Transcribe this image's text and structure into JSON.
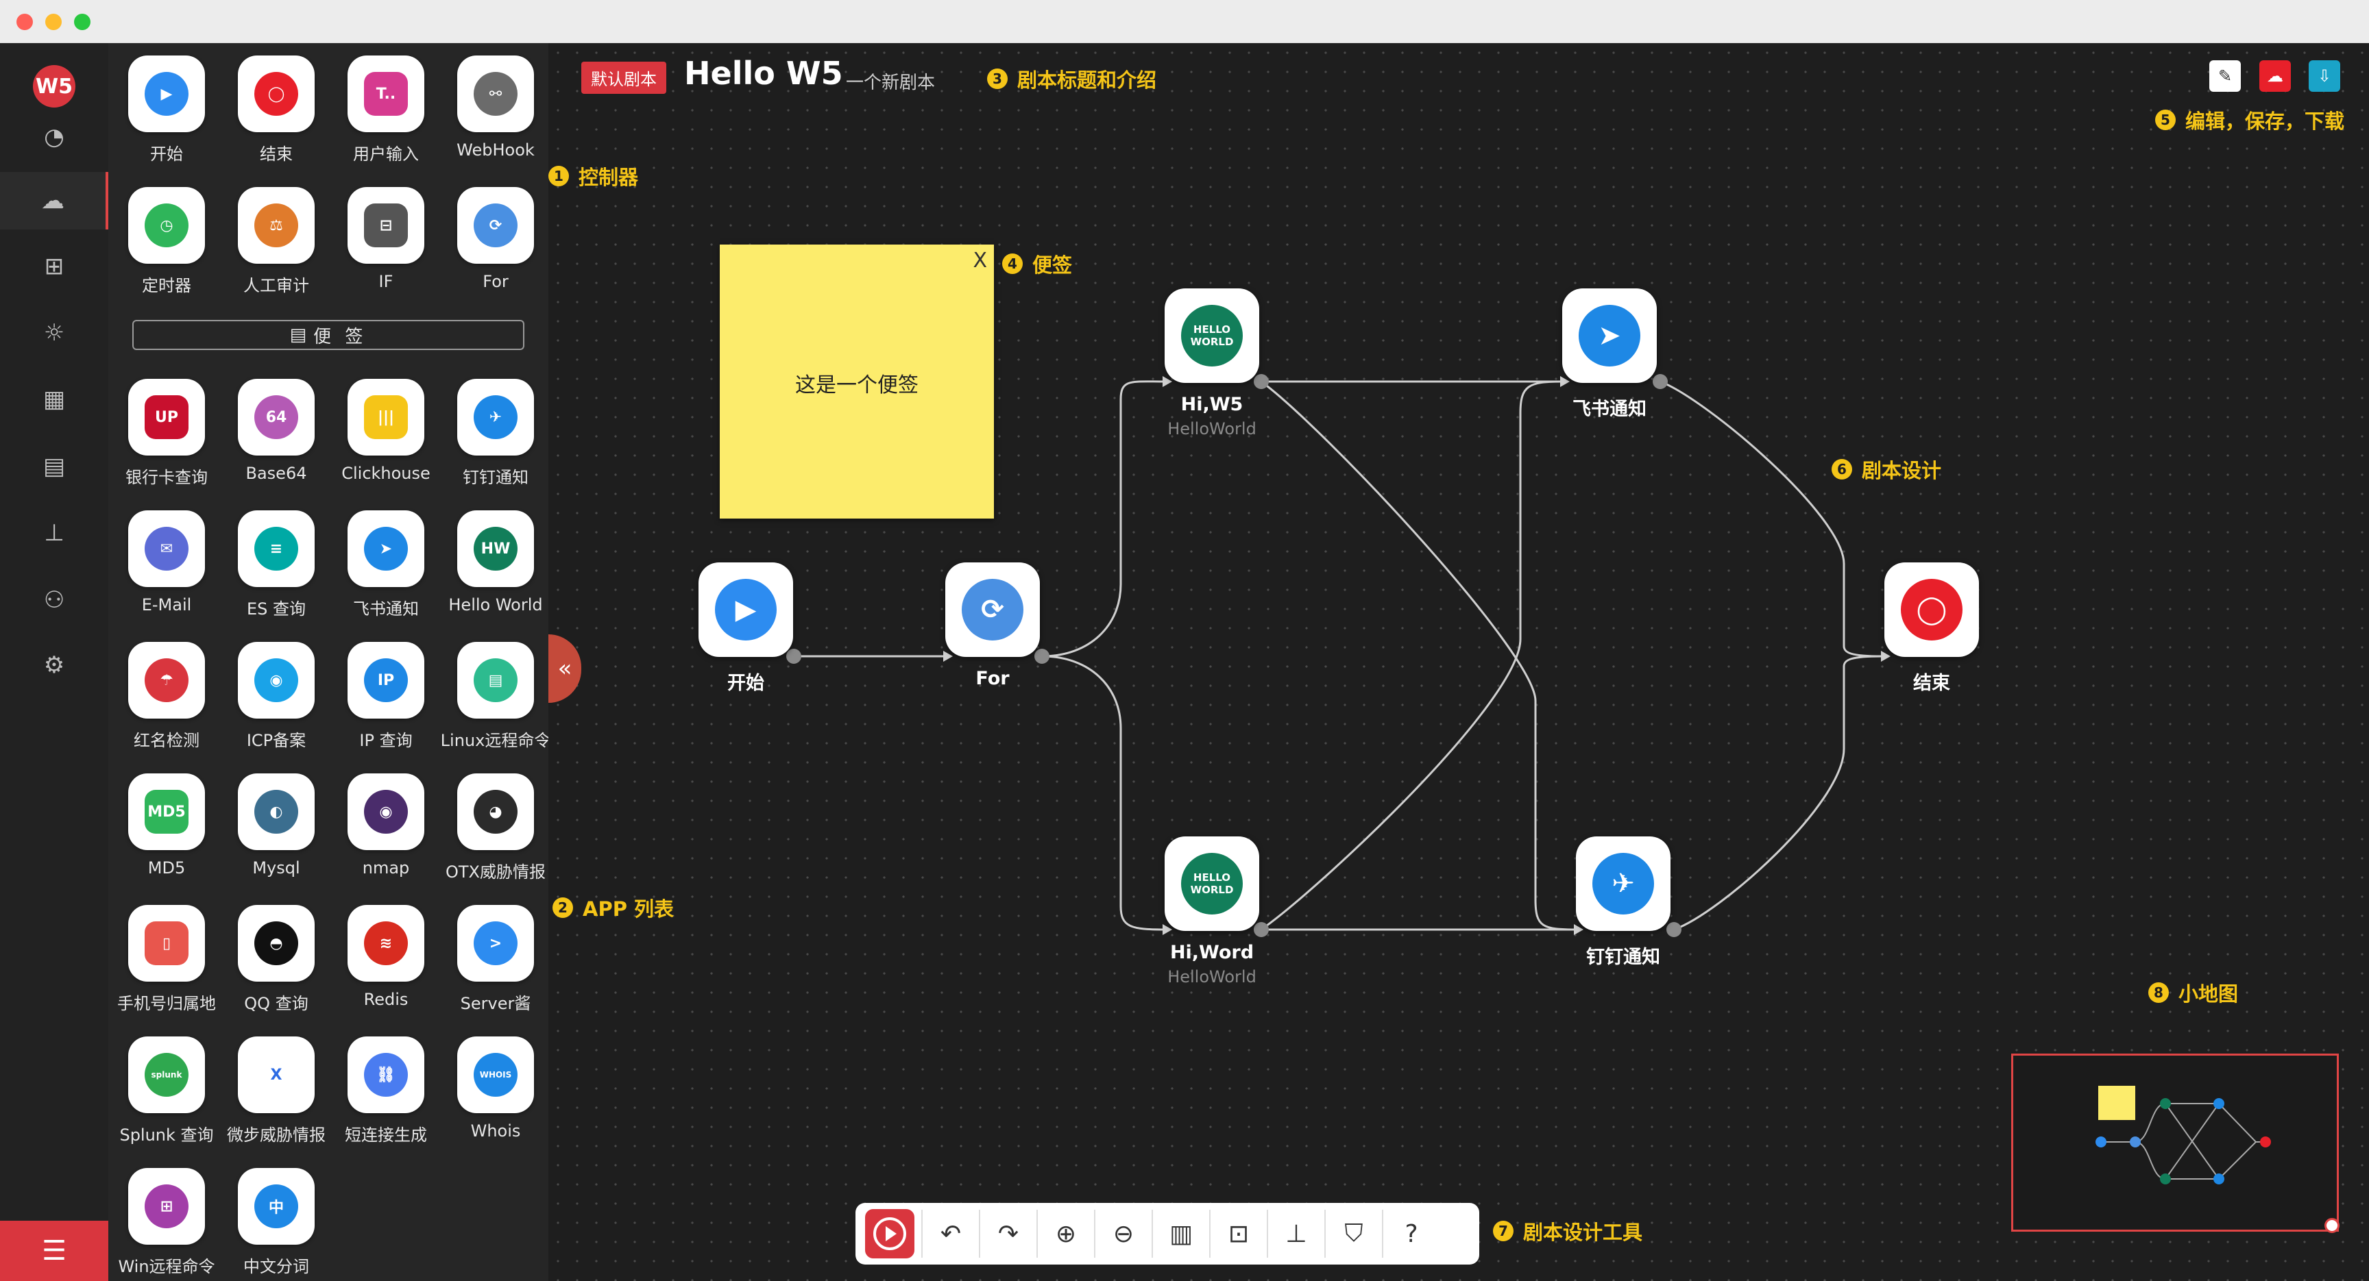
{
  "script": {
    "badge": "默认剧本",
    "title": "Hello W5",
    "desc": "一个新剧本"
  },
  "sidebar": {
    "logo": "W5",
    "items": [
      {
        "icon": "dashboard-icon",
        "glyph": "◔"
      },
      {
        "icon": "cloud-workflow-icon",
        "glyph": "☁",
        "active": true
      },
      {
        "icon": "hierarchy-icon",
        "glyph": "⊞"
      },
      {
        "icon": "bug-icon",
        "glyph": "☼"
      },
      {
        "icon": "apps-grid-icon",
        "glyph": "▦"
      },
      {
        "icon": "document-icon",
        "glyph": "▤"
      },
      {
        "icon": "org-chart-icon",
        "glyph": "⊥"
      },
      {
        "icon": "user-icon",
        "glyph": "⚇"
      },
      {
        "icon": "settings-icon",
        "glyph": "⚙"
      }
    ],
    "bottom_glyph": "☰"
  },
  "note_button": {
    "icon": "▤",
    "label": "便 签"
  },
  "apps": [
    {
      "name": "开始",
      "icon": "start-icon",
      "glyph": "▶",
      "color": "#2d8cf0",
      "shape": "circ"
    },
    {
      "name": "结束",
      "icon": "end-icon",
      "glyph": "◯",
      "color": "#e8202a",
      "shape": "circ"
    },
    {
      "name": "用户输入",
      "icon": "user-input-icon",
      "glyph": "T..",
      "color": "#d63a8f",
      "shape": "sqr"
    },
    {
      "name": "WebHook",
      "icon": "webhook-icon",
      "glyph": "⚯",
      "color": "#6b6b6b",
      "shape": "circ"
    },
    {
      "name": "定时器",
      "icon": "timer-icon",
      "glyph": "◷",
      "color": "#2fb55a",
      "shape": "circ"
    },
    {
      "name": "人工审计",
      "icon": "audit-icon",
      "glyph": "⚖",
      "color": "#e07b2c",
      "shape": "circ"
    },
    {
      "name": "IF",
      "icon": "if-icon",
      "glyph": "⊟",
      "color": "#555555",
      "shape": "sqr"
    },
    {
      "name": "For",
      "icon": "for-icon",
      "glyph": "⟳",
      "color": "#4a90e2",
      "shape": "circ"
    },
    {
      "name": "银行卡查询",
      "icon": "unionpay-icon",
      "glyph": "UP",
      "color": "#c8102e",
      "shape": "sqr"
    },
    {
      "name": "Base64",
      "icon": "base64-icon",
      "glyph": "64",
      "color": "#b45ab5",
      "shape": "circ"
    },
    {
      "name": "Clickhouse",
      "icon": "clickhouse-icon",
      "glyph": "|||",
      "color": "#f5c518",
      "shape": "sqr"
    },
    {
      "name": "钉钉通知",
      "icon": "dingtalk-icon",
      "glyph": "✈",
      "color": "#1e88e5",
      "shape": "circ"
    },
    {
      "name": "E-Mail",
      "icon": "email-icon",
      "glyph": "✉",
      "color": "#5c6bd6",
      "shape": "circ"
    },
    {
      "name": "ES 查询",
      "icon": "elasticsearch-icon",
      "glyph": "≡",
      "color": "#00a9a5",
      "shape": "circ"
    },
    {
      "name": "飞书通知",
      "icon": "feishu-icon",
      "glyph": "➤",
      "color": "#1e88e5",
      "shape": "circ"
    },
    {
      "name": "Hello World",
      "icon": "hello-world-icon",
      "glyph": "HW",
      "color": "#127e5a",
      "shape": "circ"
    },
    {
      "name": "红名检测",
      "icon": "umbrella-icon",
      "glyph": "☂",
      "color": "#d9363e",
      "shape": "circ"
    },
    {
      "name": "ICP备案",
      "icon": "globe-icon",
      "glyph": "◉",
      "color": "#1aa3e8",
      "shape": "circ"
    },
    {
      "name": "IP 查询",
      "icon": "ip-icon",
      "glyph": "IP",
      "color": "#1e88e5",
      "shape": "circ"
    },
    {
      "name": "Linux远程命令",
      "icon": "server-icon",
      "glyph": "▤",
      "color": "#2dbb8f",
      "shape": "circ"
    },
    {
      "name": "MD5",
      "icon": "md5-icon",
      "glyph": "MD5",
      "color": "#2fb55a",
      "shape": "sqr"
    },
    {
      "name": "Mysql",
      "icon": "mysql-icon",
      "glyph": "◐",
      "color": "#3b6e8f",
      "shape": "circ"
    },
    {
      "name": "nmap",
      "icon": "nmap-icon",
      "glyph": "◉",
      "color": "#4a2c6b",
      "shape": "circ"
    },
    {
      "name": "OTX威胁情报",
      "icon": "alien-icon",
      "glyph": "◕",
      "color": "#2b2b2b",
      "shape": "circ"
    },
    {
      "name": "手机号归属地",
      "icon": "phone-icon",
      "glyph": "▯",
      "color": "#e8564d",
      "shape": "sqr"
    },
    {
      "name": "QQ 查询",
      "icon": "qq-icon",
      "glyph": "◓",
      "color": "#111111",
      "shape": "circ"
    },
    {
      "name": "Redis",
      "icon": "redis-icon",
      "glyph": "≋",
      "color": "#d82c20",
      "shape": "circ"
    },
    {
      "name": "Server酱",
      "icon": "server-chan-icon",
      "glyph": ">",
      "color": "#2d8cf0",
      "shape": "circ"
    },
    {
      "name": "Splunk 查询",
      "icon": "splunk-icon",
      "glyph": "splunk",
      "color": "#2fa84f",
      "shape": "circ"
    },
    {
      "name": "微步威胁情报",
      "icon": "threatbook-icon",
      "glyph": "X",
      "color": "#ffffff",
      "shape": "sqr",
      "fg": "#2d6be4"
    },
    {
      "name": "短连接生成",
      "icon": "link-icon",
      "glyph": "⛓",
      "color": "#4a7cf0",
      "shape": "circ"
    },
    {
      "name": "Whois",
      "icon": "whois-icon",
      "glyph": "WHOIS",
      "color": "#1e88e5",
      "shape": "circ"
    },
    {
      "name": "Win远程命令",
      "icon": "windows-icon",
      "glyph": "⊞",
      "color": "#a23ea8",
      "shape": "circ"
    },
    {
      "name": "中文分词",
      "icon": "chinese-segment-icon",
      "glyph": "中",
      "color": "#1e88e5",
      "shape": "circ"
    }
  ],
  "sticky": {
    "close": "X",
    "text": "这是一个便签"
  },
  "nodes": [
    {
      "key": "start",
      "name": "开始",
      "sub": "",
      "glyph": "▶",
      "color": "#2d8cf0"
    },
    {
      "key": "for",
      "name": "For",
      "sub": "",
      "glyph": "⟳",
      "color": "#4a90e2"
    },
    {
      "key": "hi1",
      "name": "Hi,W5",
      "sub": "HelloWorld",
      "glyph": "HELLO WORLD",
      "color": "#127e5a"
    },
    {
      "key": "hi2",
      "name": "Hi,Word",
      "sub": "HelloWorld",
      "glyph": "HELLO WORLD",
      "color": "#127e5a"
    },
    {
      "key": "feishu",
      "name": "飞书通知",
      "sub": "",
      "glyph": "➤",
      "color": "#1e88e5"
    },
    {
      "key": "ding",
      "name": "钉钉通知",
      "sub": "",
      "glyph": "✈",
      "color": "#1e88e5"
    },
    {
      "key": "end",
      "name": "结束",
      "sub": "",
      "glyph": "◯",
      "color": "#e8202a"
    }
  ],
  "annotations": [
    {
      "n": "1",
      "text": "控制器"
    },
    {
      "n": "2",
      "text": "APP 列表"
    },
    {
      "n": "3",
      "text": "剧本标题和介绍"
    },
    {
      "n": "4",
      "text": "便签"
    },
    {
      "n": "5",
      "text": "编辑，保存，下载"
    },
    {
      "n": "6",
      "text": "剧本设计"
    },
    {
      "n": "7",
      "text": "剧本设计工具"
    },
    {
      "n": "8",
      "text": "小地图"
    }
  ],
  "top_buttons": [
    {
      "icon": "edit-icon",
      "glyph": "✎",
      "color": "#ffffff",
      "fg": "#333333"
    },
    {
      "icon": "save-cloud-icon",
      "glyph": "☁",
      "color": "#e8202a",
      "fg": "#ffffff"
    },
    {
      "icon": "download-cloud-icon",
      "glyph": "⇩",
      "color": "#1aa3c8",
      "fg": "#ffffff"
    }
  ],
  "toolbar": [
    {
      "icon": "undo-icon",
      "glyph": "↶"
    },
    {
      "icon": "redo-icon",
      "glyph": "↷"
    },
    {
      "icon": "zoom-in-icon",
      "glyph": "⊕"
    },
    {
      "icon": "zoom-out-icon",
      "glyph": "⊖"
    },
    {
      "icon": "fit-view-icon",
      "glyph": "▥"
    },
    {
      "icon": "actual-size-icon",
      "glyph": "⊡"
    },
    {
      "icon": "auto-layout-icon",
      "glyph": "⊥"
    },
    {
      "icon": "shirt-icon",
      "glyph": "⛉"
    },
    {
      "icon": "help-icon",
      "glyph": "?"
    }
  ],
  "collapse_glyph": "«"
}
